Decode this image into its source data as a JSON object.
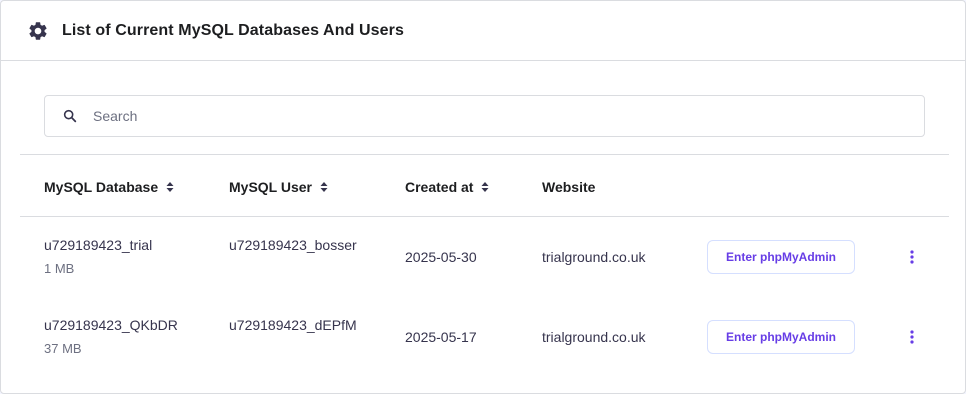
{
  "header": {
    "title": "List of Current MySQL Databases And Users"
  },
  "search": {
    "placeholder": "Search",
    "value": ""
  },
  "table": {
    "columns": [
      "MySQL Database",
      "MySQL User",
      "Created at",
      "Website"
    ],
    "rows": [
      {
        "database": "u729189423_trial",
        "size": "1 MB",
        "user": "u729189423_bosser",
        "created": "2025-05-30",
        "website": "trialground.co.uk",
        "action": "Enter phpMyAdmin"
      },
      {
        "database": "u729189423_QKbDR",
        "size": "37 MB",
        "user": "u729189423_dEPfM",
        "created": "2025-05-17",
        "website": "trialground.co.uk",
        "action": "Enter phpMyAdmin"
      }
    ]
  },
  "colors": {
    "accent": "#673de6",
    "text": "#1d1e20",
    "muted": "#6d7081",
    "border": "#dadce0"
  },
  "icons": {
    "header": "gear-icon",
    "search": "search-icon",
    "sort": "sort-icon",
    "menu": "kebab-menu-icon"
  }
}
